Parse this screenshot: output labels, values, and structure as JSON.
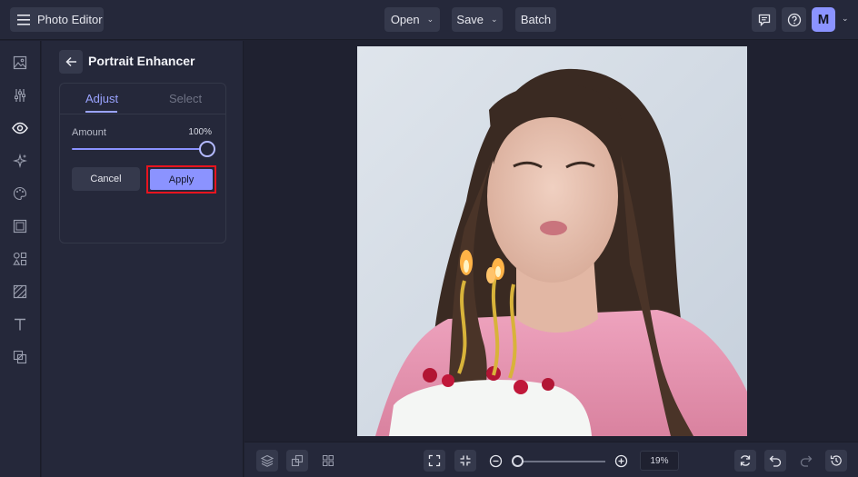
{
  "header": {
    "app_title": "Photo Editor",
    "open_label": "Open",
    "save_label": "Save",
    "batch_label": "Batch",
    "avatar_initial": "M"
  },
  "sidebar": {
    "icons": [
      "image-icon",
      "sliders-icon",
      "eye-icon",
      "sparkles-icon",
      "palette-icon",
      "frame-icon",
      "shapes-icon",
      "texture-icon",
      "text-icon",
      "overlay-icon"
    ],
    "active": "eye-icon"
  },
  "panel": {
    "title": "Portrait Enhancer",
    "tabs": [
      {
        "label": "Adjust",
        "active": true
      },
      {
        "label": "Select",
        "active": false
      }
    ],
    "amount_label": "Amount",
    "amount_value": "100%",
    "amount_fraction": 1.0,
    "cancel_label": "Cancel",
    "apply_label": "Apply",
    "highlight_color": "#e8141e"
  },
  "bottombar": {
    "zoom_value": "19%",
    "zoom_fraction": 0.19
  },
  "colors": {
    "accent": "#8b93ff",
    "bg": "#1f2130",
    "panel": "#25283a",
    "button": "#35394c"
  }
}
